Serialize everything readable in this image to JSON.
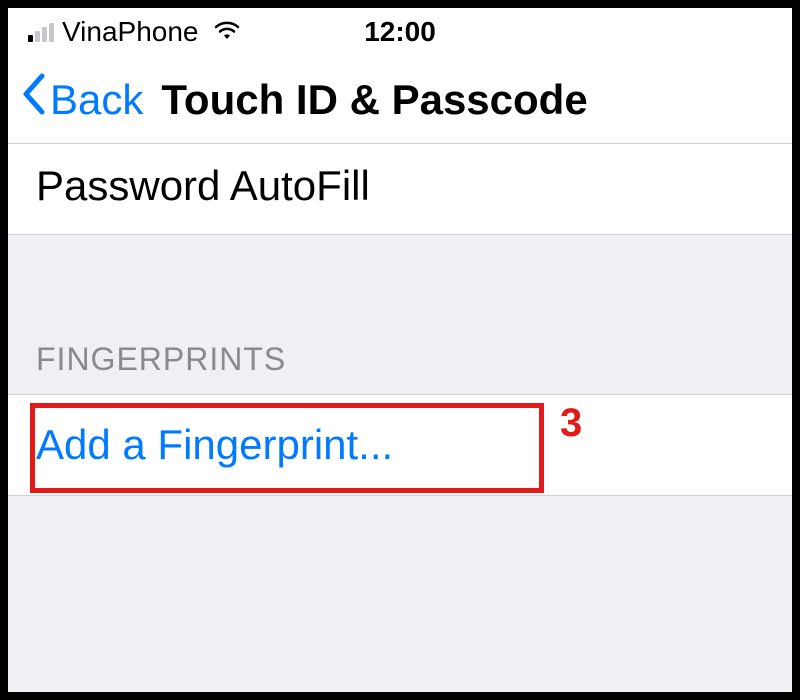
{
  "statusBar": {
    "carrier": "VinaPhone",
    "time": "12:00"
  },
  "nav": {
    "backLabel": "Back",
    "title": "Touch ID & Passcode"
  },
  "rows": {
    "passwordAutofill": "Password AutoFill"
  },
  "sections": {
    "fingerprintsHeader": "FINGERPRINTS",
    "addFingerprint": "Add a Fingerprint..."
  },
  "annotation": {
    "number": "3"
  }
}
